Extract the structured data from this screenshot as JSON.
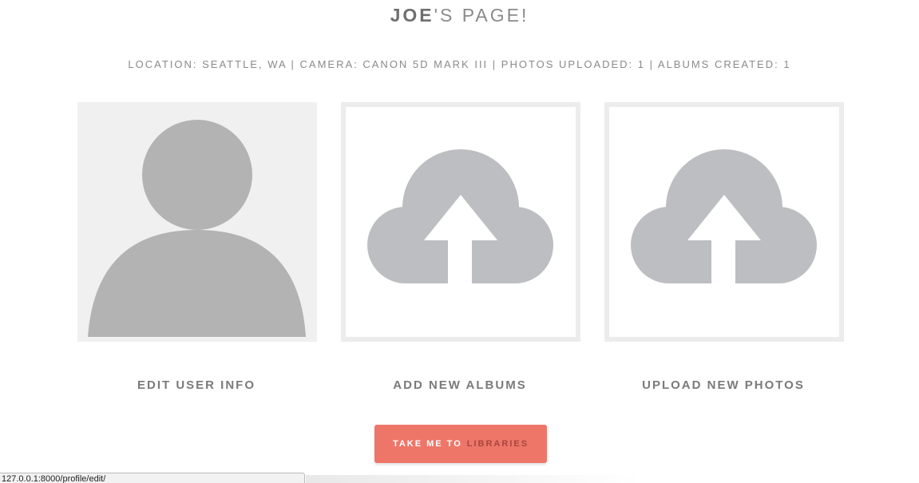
{
  "header": {
    "name": "JOE",
    "title_suffix": "'S PAGE!"
  },
  "stats": {
    "text": "LOCATION: SEATTLE, WA | CAMERA: CANON 5D MARK III | PHOTOS UPLOADED: 1 | ALBUMS CREATED: 1"
  },
  "tiles": [
    {
      "icon": "user-silhouette-icon",
      "label": "EDIT USER INFO"
    },
    {
      "icon": "cloud-upload-icon",
      "label": "ADD NEW ALBUMS"
    },
    {
      "icon": "cloud-upload-icon",
      "label": "UPLOAD NEW PHOTOS"
    }
  ],
  "cta": {
    "prefix": "TAKE ME TO",
    "accent": "LIBRARIES"
  },
  "status_bar": {
    "url": "127.0.0.1:8000/profile/edit/"
  },
  "colors": {
    "cta_background": "#ee7669",
    "cta_accent_text": "#a8463d",
    "icon_gray": "#bdbec1",
    "avatar_gray": "#b3b3b3",
    "tile_border": "#ececec"
  }
}
